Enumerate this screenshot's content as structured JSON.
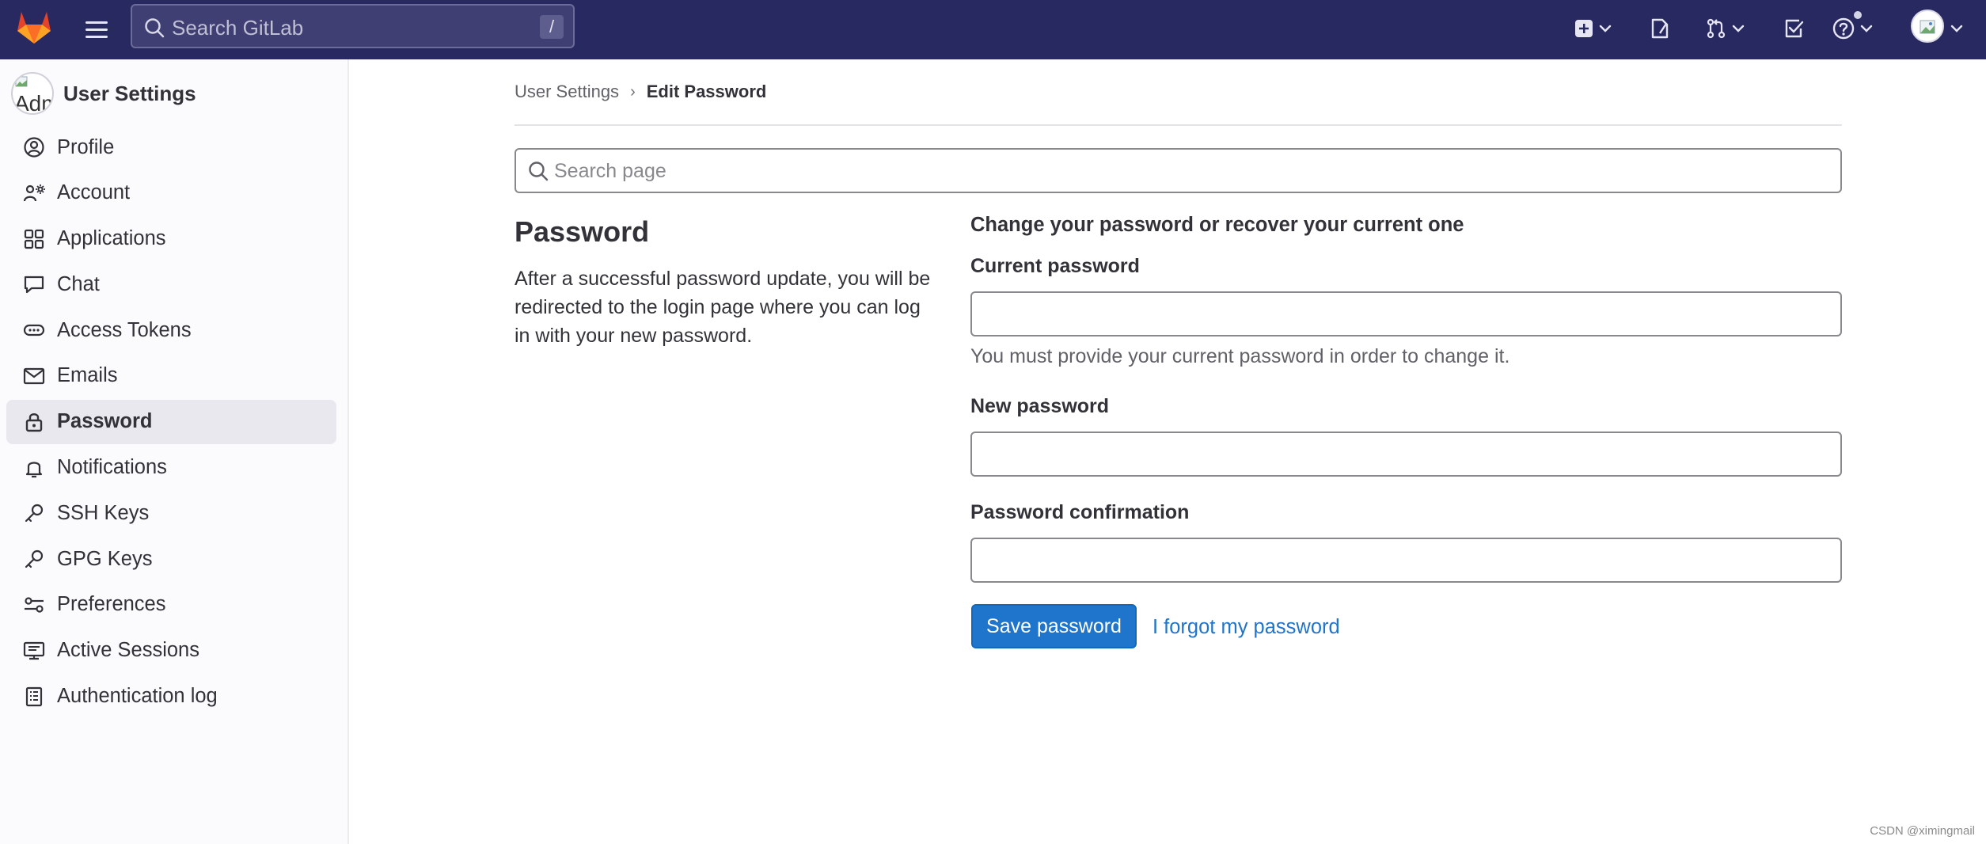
{
  "topbar": {
    "search_placeholder": "Search GitLab",
    "search_shortcut": "/",
    "icons": [
      "gitlab-logo",
      "hamburger-menu",
      "create-new",
      "issues",
      "merge-requests",
      "todos",
      "help",
      "user-avatar"
    ]
  },
  "sidebar": {
    "title": "User Settings",
    "avatar_alt": "Adm",
    "items": [
      {
        "label": "Profile",
        "icon": "profile-icon"
      },
      {
        "label": "Account",
        "icon": "account-icon"
      },
      {
        "label": "Applications",
        "icon": "applications-icon"
      },
      {
        "label": "Chat",
        "icon": "chat-icon"
      },
      {
        "label": "Access Tokens",
        "icon": "token-icon"
      },
      {
        "label": "Emails",
        "icon": "mail-icon"
      },
      {
        "label": "Password",
        "icon": "lock-icon",
        "active": true
      },
      {
        "label": "Notifications",
        "icon": "bell-icon"
      },
      {
        "label": "SSH Keys",
        "icon": "key-icon"
      },
      {
        "label": "GPG Keys",
        "icon": "key-icon"
      },
      {
        "label": "Preferences",
        "icon": "preferences-icon"
      },
      {
        "label": "Active Sessions",
        "icon": "monitor-icon"
      },
      {
        "label": "Authentication log",
        "icon": "log-icon"
      }
    ]
  },
  "breadcrumb": {
    "parent": "User Settings",
    "separator": "›",
    "current": "Edit Password"
  },
  "page_search": {
    "placeholder": "Search page"
  },
  "section": {
    "title": "Password",
    "description": "After a successful password update, you will be redirected to the login page where you can log in with your new password."
  },
  "form": {
    "heading": "Change your password or recover your current one",
    "current_password_label": "Current password",
    "current_password_value": "",
    "current_password_help": "You must provide your current password in order to change it.",
    "new_password_label": "New password",
    "new_password_value": "",
    "confirmation_label": "Password confirmation",
    "confirmation_value": "",
    "save_button": "Save password",
    "forgot_link": "I forgot my password"
  },
  "watermark": "CSDN @ximingmail",
  "colors": {
    "topbar": "#292961",
    "primary": "#1f75cb",
    "sidebar_bg": "#fbfafd",
    "active_item_bg": "#e9e8ee"
  }
}
